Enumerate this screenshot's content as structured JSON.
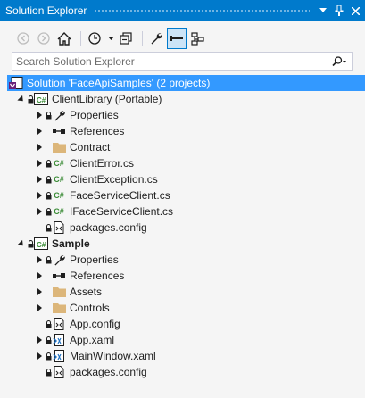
{
  "window": {
    "title": "Solution Explorer"
  },
  "search": {
    "placeholder": "Search Solution Explorer"
  },
  "colors": {
    "accent": "#007acc",
    "selection": "#3399ff",
    "folder": "#dcb67a",
    "csharp": "#388a34"
  },
  "tree": {
    "solution": "Solution 'FaceApiSamples' (2 projects)",
    "client_library": {
      "name": "ClientLibrary (Portable)",
      "items": [
        "Properties",
        "References",
        "Contract",
        "ClientError.cs",
        "ClientException.cs",
        "FaceServiceClient.cs",
        "IFaceServiceClient.cs",
        "packages.config"
      ]
    },
    "sample": {
      "name": "Sample",
      "items": [
        "Properties",
        "References",
        "Assets",
        "Controls",
        "App.config",
        "App.xaml",
        "MainWindow.xaml",
        "packages.config"
      ]
    }
  }
}
